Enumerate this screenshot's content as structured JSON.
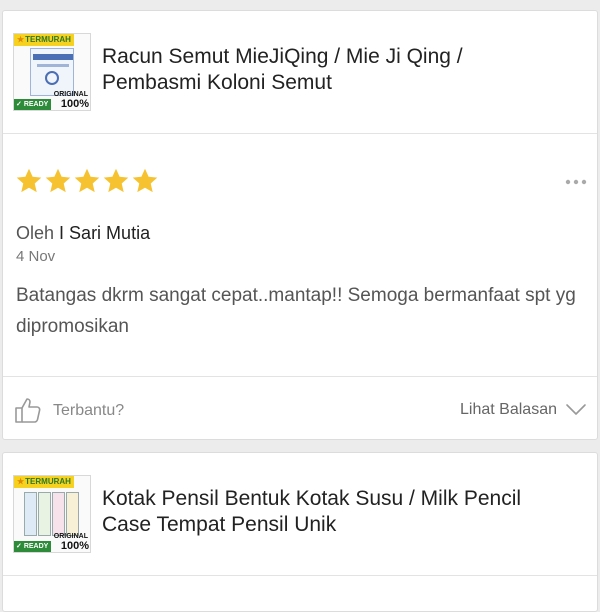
{
  "review_card": {
    "product": {
      "title": "Racun Semut MieJiQing / Mie Ji Qing / Pembasmi Koloni Semut",
      "thumbnail_icon": "ant-poison-box-thumbnail",
      "badge": {
        "top_label": "TERMURAH",
        "ready_label": "READY",
        "original_label": "ORIGINAL",
        "percent_label": "100%"
      }
    },
    "rating": {
      "value": 5,
      "max": 5,
      "star_color": "#f6c22f"
    },
    "reviewer": {
      "prefix": "Oleh",
      "name": "I Sari Mutia"
    },
    "date": "4 Nov",
    "text": "Batangas dkrm sangat cepat..mantap!! Semoga bermanfaat spt yg dipromosikan",
    "actions": {
      "helpful_label": "Terbantu?",
      "replies_label": "Lihat Balasan"
    },
    "icons": {
      "helpful": "thumbs-up-icon",
      "replies": "chevron-down-icon",
      "more": "more-options-icon"
    }
  },
  "next_card": {
    "product": {
      "title": "Kotak Pensil Bentuk Kotak Susu / Milk Pencil Case Tempat Pensil Unik",
      "thumbnail_icon": "milk-pencil-case-thumbnail",
      "badge": {
        "top_label": "TERMURAH",
        "ready_label": "READY",
        "original_label": "ORIGINAL",
        "percent_label": "100%"
      }
    }
  },
  "colors": {
    "background": "#ececec",
    "card": "#ffffff",
    "star": "#f6c22f",
    "badge_yellow": "#f7d11f",
    "badge_green": "#2e8b3a"
  }
}
